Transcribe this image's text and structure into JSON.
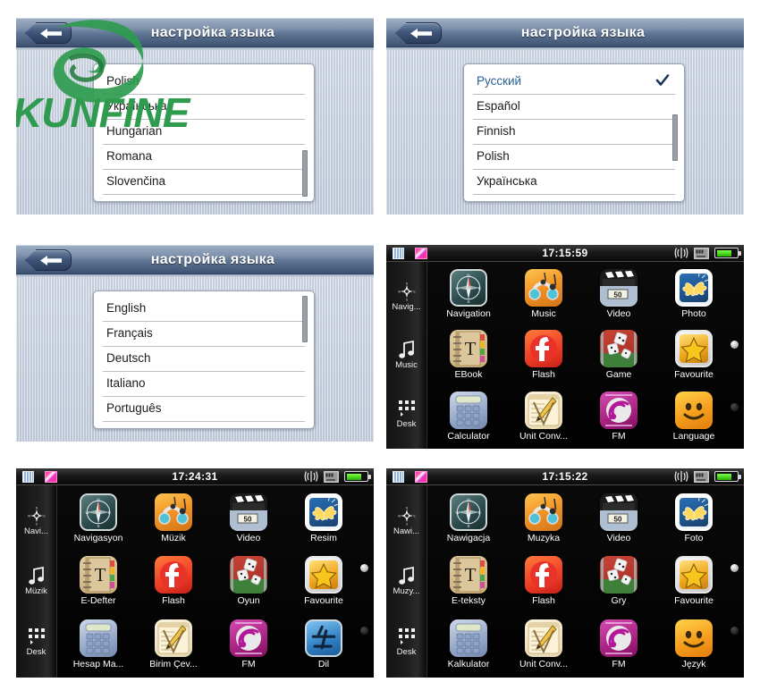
{
  "panels": [
    {
      "id": "lang-scrolled",
      "title": "настройка языка",
      "back_icon": "back-arrow-icon",
      "rows": [
        {
          "label": "Polish",
          "selected": false,
          "check": false
        },
        {
          "label": "Українська",
          "selected": false,
          "check": false
        },
        {
          "label": "Hungarian",
          "selected": false,
          "check": false
        },
        {
          "label": "Romana",
          "selected": false,
          "check": false
        },
        {
          "label": "Slovenčina",
          "selected": false,
          "check": false
        }
      ],
      "scroll_top_pct": 56,
      "watermark": {
        "text": "KUNFINE",
        "color": "#1f9040"
      }
    },
    {
      "id": "lang-russian",
      "title": "настройка языка",
      "back_icon": "back-arrow-icon",
      "rows": [
        {
          "label": "Русский",
          "selected": true,
          "check": true
        },
        {
          "label": "Español",
          "selected": false,
          "check": false
        },
        {
          "label": "Finnish",
          "selected": false,
          "check": false
        },
        {
          "label": "Polish",
          "selected": false,
          "check": false
        },
        {
          "label": "Українська",
          "selected": false,
          "check": false
        }
      ],
      "scroll_top_pct": 33
    },
    {
      "id": "lang-english",
      "title": "настройка языка",
      "back_icon": "back-arrow-icon",
      "rows": [
        {
          "label": "English",
          "selected": false,
          "check": false
        },
        {
          "label": "Français",
          "selected": false,
          "check": false
        },
        {
          "label": "Deutsch",
          "selected": false,
          "check": false
        },
        {
          "label": "Italiano",
          "selected": false,
          "check": false
        },
        {
          "label": "Português",
          "selected": false,
          "check": false
        }
      ],
      "scroll_top_pct": 2
    }
  ],
  "launchers": [
    {
      "id": "launcher-english",
      "status": {
        "time": "17:15:59",
        "grid_icon": "window-grid-icon",
        "pink_icon": "color-swatch-icon",
        "signal_icon": "signal-waves-icon",
        "sd_icon": "sd-card-icon",
        "battery_icon": "battery-icon"
      },
      "rail": [
        {
          "icon": "compass-icon",
          "label": "Navig..."
        },
        {
          "icon": "music-note-icon",
          "label": "Music"
        },
        {
          "icon": "app-grid-icon",
          "label": "Desk"
        }
      ],
      "apps": [
        {
          "icon": "navigation-icon",
          "label": "Navigation"
        },
        {
          "icon": "music-icon",
          "label": "Music"
        },
        {
          "icon": "video-icon",
          "label": "Video"
        },
        {
          "icon": "photo-icon",
          "label": "Photo"
        },
        {
          "icon": "ebook-icon",
          "label": "EBook"
        },
        {
          "icon": "flash-icon",
          "label": "Flash"
        },
        {
          "icon": "game-icon",
          "label": "Game"
        },
        {
          "icon": "favourite-icon",
          "label": "Favourite"
        },
        {
          "icon": "calculator-icon",
          "label": "Calculator"
        },
        {
          "icon": "unit-convert-icon",
          "label": "Unit Conv..."
        },
        {
          "icon": "fm-radio-icon",
          "label": "FM"
        },
        {
          "icon": "language-icon",
          "label": "Language"
        }
      ]
    },
    {
      "id": "launcher-turkish",
      "status": {
        "time": "17:24:31",
        "grid_icon": "window-grid-icon",
        "pink_icon": "color-swatch-icon",
        "signal_icon": "signal-waves-icon",
        "sd_icon": "sd-card-icon",
        "battery_icon": "battery-icon"
      },
      "rail": [
        {
          "icon": "compass-icon",
          "label": "Navi..."
        },
        {
          "icon": "music-note-icon",
          "label": "Müzik"
        },
        {
          "icon": "app-grid-icon",
          "label": "Desk"
        }
      ],
      "apps": [
        {
          "icon": "navigation-icon",
          "label": "Navigasyon"
        },
        {
          "icon": "music-icon",
          "label": "Müzik"
        },
        {
          "icon": "video-icon",
          "label": "Video"
        },
        {
          "icon": "photo-icon",
          "label": "Resim"
        },
        {
          "icon": "ebook-icon",
          "label": "E-Defter"
        },
        {
          "icon": "flash-icon",
          "label": "Flash"
        },
        {
          "icon": "game-icon",
          "label": "Oyun"
        },
        {
          "icon": "favourite-icon",
          "label": "Favourite"
        },
        {
          "icon": "calculator-icon",
          "label": "Hesap Ma..."
        },
        {
          "icon": "unit-convert-icon",
          "label": "Birim Çev..."
        },
        {
          "icon": "fm-radio-icon",
          "label": "FM"
        },
        {
          "icon": "language-cjk-icon",
          "label": "Dil"
        }
      ]
    },
    {
      "id": "launcher-polish",
      "status": {
        "time": "17:15:22",
        "grid_icon": "window-grid-icon",
        "pink_icon": "color-swatch-icon",
        "signal_icon": "signal-waves-icon",
        "sd_icon": "sd-card-icon",
        "battery_icon": "battery-icon"
      },
      "rail": [
        {
          "icon": "compass-icon",
          "label": "Nawi..."
        },
        {
          "icon": "music-note-icon",
          "label": "Muzy..."
        },
        {
          "icon": "app-grid-icon",
          "label": "Desk"
        }
      ],
      "apps": [
        {
          "icon": "navigation-icon",
          "label": "Nawigacja"
        },
        {
          "icon": "music-icon",
          "label": "Muzyka"
        },
        {
          "icon": "video-icon",
          "label": "Video"
        },
        {
          "icon": "photo-icon",
          "label": "Foto"
        },
        {
          "icon": "ebook-icon",
          "label": "E-teksty"
        },
        {
          "icon": "flash-icon",
          "label": "Flash"
        },
        {
          "icon": "game-icon",
          "label": "Gry"
        },
        {
          "icon": "favourite-icon",
          "label": "Favourite"
        },
        {
          "icon": "calculator-icon",
          "label": "Kalkulator"
        },
        {
          "icon": "unit-convert-icon",
          "label": "Unit Conv..."
        },
        {
          "icon": "fm-radio-icon",
          "label": "FM"
        },
        {
          "icon": "language-icon",
          "label": "Język"
        }
      ]
    }
  ],
  "colors": {
    "titlebar": "#3d5272",
    "screen_bg": "#c2cad8",
    "accent_green": "#1f9040",
    "battery_green": "#25b300",
    "check_navy": "#1d3557"
  }
}
